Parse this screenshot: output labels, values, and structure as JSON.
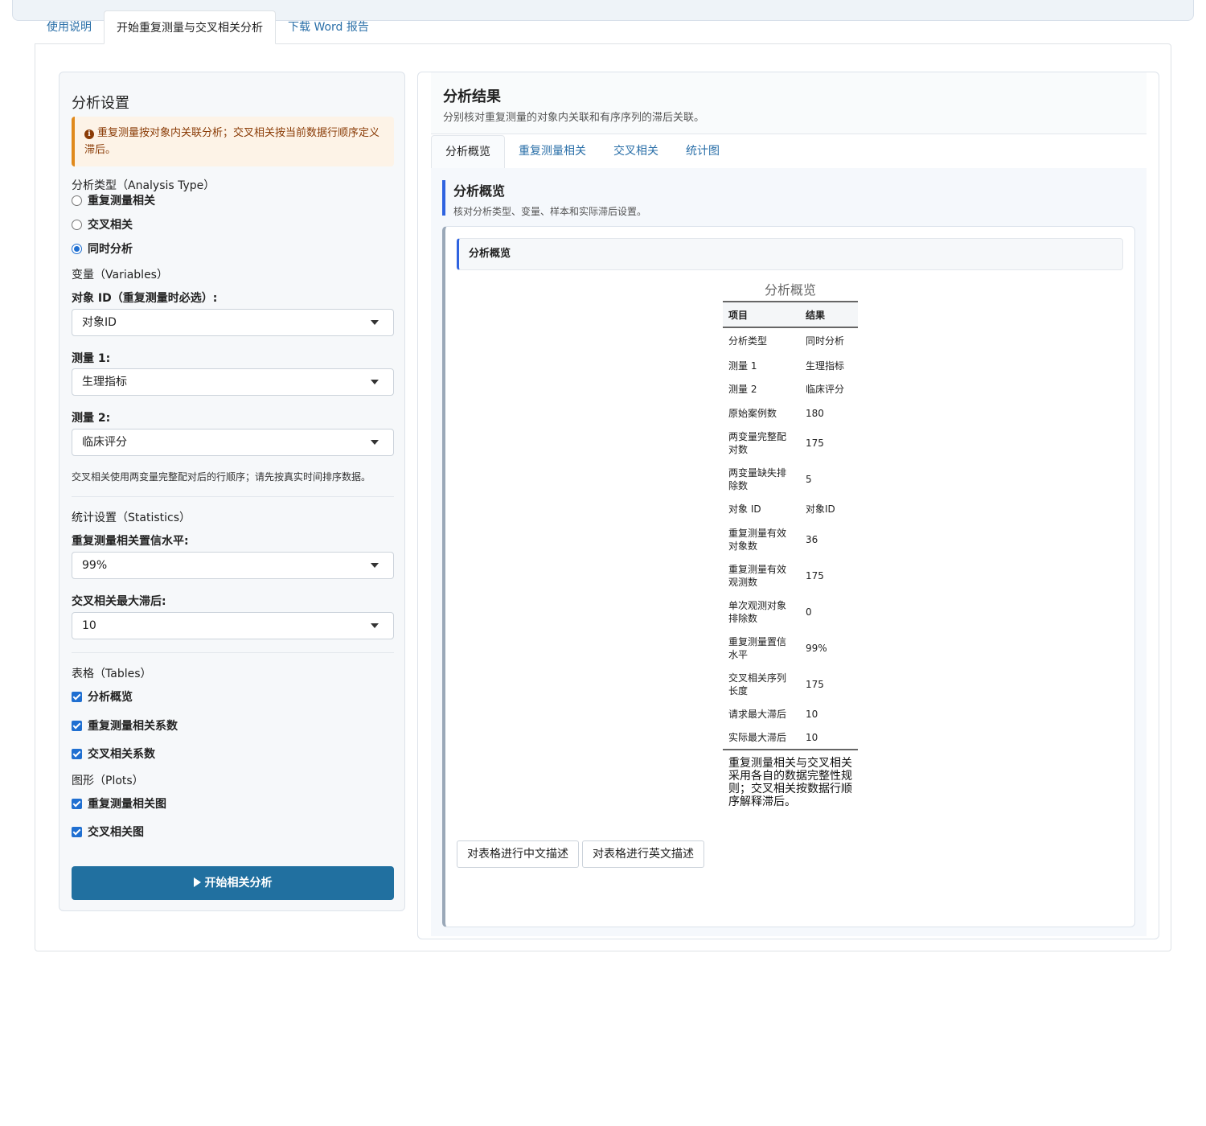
{
  "nav": {
    "tabs": [
      {
        "label": "使用说明"
      },
      {
        "label": "开始重复测量与交叉相关分析"
      },
      {
        "label": "下载 Word 报告"
      }
    ]
  },
  "sidebar": {
    "title": "分析设置",
    "alert": "重复测量按对象内关联分析；交叉相关按当前数据行顺序定义滞后。",
    "analysis_type": {
      "label": "分析类型（Analysis Type）",
      "options": [
        "重复测量相关",
        "交叉相关",
        "同时分析"
      ],
      "selected": "同时分析"
    },
    "variables": {
      "label": "变量（Variables）",
      "subject_label": "对象 ID（重复测量时必选）:",
      "subject_value": "对象ID",
      "m1_label": "测量 1:",
      "m1_value": "生理指标",
      "m2_label": "测量 2:",
      "m2_value": "临床评分",
      "hint": "交叉相关使用两变量完整配对后的行顺序；请先按真实时间排序数据。"
    },
    "statistics": {
      "label": "统计设置（Statistics）",
      "conf_label": "重复测量相关置信水平:",
      "conf_value": "99%",
      "lag_label": "交叉相关最大滞后:",
      "lag_value": "10"
    },
    "tables": {
      "label": "表格（Tables）",
      "items": [
        "分析概览",
        "重复测量相关系数",
        "交叉相关系数"
      ]
    },
    "plots": {
      "label": "图形（Plots）",
      "items": [
        "重复测量相关图",
        "交叉相关图"
      ]
    },
    "run_label": "开始相关分析"
  },
  "results": {
    "title": "分析结果",
    "subtitle": "分别核对重复测量的对象内关联和有序序列的滞后关联。",
    "tabs": [
      {
        "label": "分析概览"
      },
      {
        "label": "重复测量相关"
      },
      {
        "label": "交叉相关"
      },
      {
        "label": "统计图"
      }
    ],
    "overview": {
      "title": "分析概览",
      "subtitle": "核对分析类型、变量、样本和实际滞后设置。",
      "card_title": "分析概览",
      "table_caption": "分析概览",
      "headers": [
        "项目",
        "结果"
      ],
      "rows": [
        [
          "分析类型",
          "同时分析"
        ],
        [
          "测量 1",
          "生理指标"
        ],
        [
          "测量 2",
          "临床评分"
        ],
        [
          "原始案例数",
          "180"
        ],
        [
          "两变量完整配对数",
          "175"
        ],
        [
          "两变量缺失排除数",
          "5"
        ],
        [
          "对象 ID",
          "对象ID"
        ],
        [
          "重复测量有效对象数",
          "36"
        ],
        [
          "重复测量有效观测数",
          "175"
        ],
        [
          "单次观测对象排除数",
          "0"
        ],
        [
          "重复测量置信水平",
          "99%"
        ],
        [
          "交叉相关序列长度",
          "175"
        ],
        [
          "请求最大滞后",
          "10"
        ],
        [
          "实际最大滞后",
          "10"
        ]
      ],
      "note": "重复测量相关与交叉相关采用各自的数据完整性规则；交叉相关按数据行顺序解释滞后。",
      "btn_cn": "对表格进行中文描述",
      "btn_en": "对表格进行英文描述"
    }
  }
}
